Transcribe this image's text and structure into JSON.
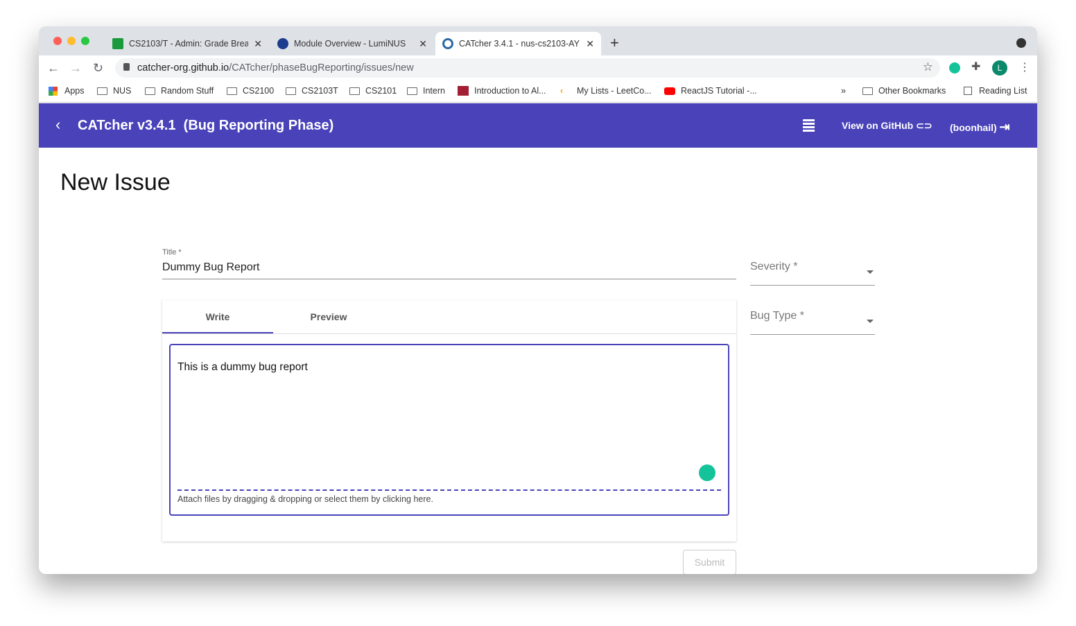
{
  "browser": {
    "tabs": [
      {
        "label": "CS2103/T - Admin: Grade Brea",
        "active": false
      },
      {
        "label": "Module Overview - LumiNUS",
        "active": false
      },
      {
        "label": "CATcher 3.4.1 - nus-cs2103-AY",
        "active": true
      }
    ],
    "url_host": "catcher-org.github.io",
    "url_path": "/CATcher/phaseBugReporting/issues/new",
    "profile_initial": "L",
    "bookmarks": [
      "Apps",
      "NUS",
      "Random Stuff",
      "CS2100",
      "CS2103T",
      "CS2101",
      "Intern",
      "Introduction to Al...",
      "My Lists - LeetCo...",
      "ReactJS Tutorial -..."
    ],
    "other_bookmarks": "Other Bookmarks",
    "reading_list": "Reading List"
  },
  "app": {
    "title": "CATcher v3.4.1  (Bug Reporting Phase)",
    "github": "View on GitHub",
    "user": "(boonhail)",
    "accent": "#4942b9"
  },
  "page": {
    "heading": "New Issue",
    "title_label": "Title *",
    "title_value": "Dummy Bug Report",
    "severity_label": "Severity *",
    "bug_type_label": "Bug Type *",
    "tab_write": "Write",
    "tab_preview": "Preview",
    "body": "This is a dummy bug report",
    "attach_hint": "Attach files by dragging & dropping or select them by clicking here.",
    "submit": "Submit"
  }
}
